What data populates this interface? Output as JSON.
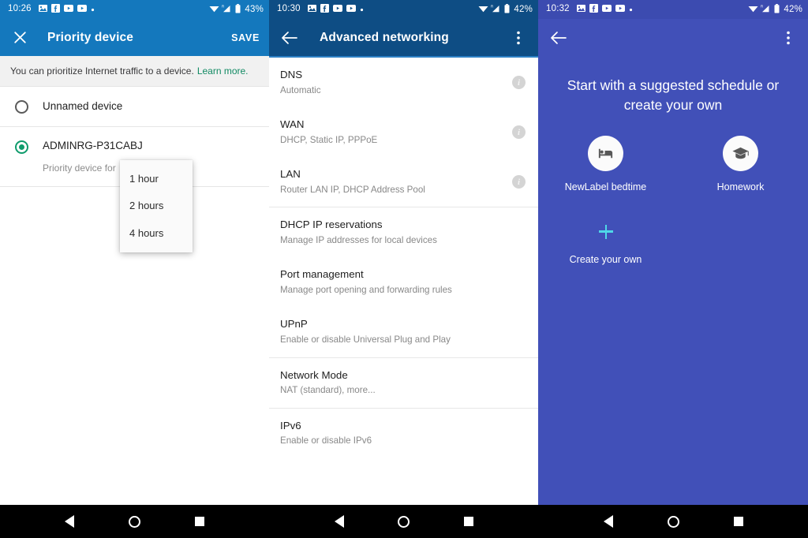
{
  "panels": [
    {
      "status": {
        "time": "10:26",
        "battery_pct": "43%",
        "icons": [
          "photo-icon",
          "facebook-icon",
          "youtube-icon",
          "youtube-icon",
          "dot-icon"
        ],
        "right_icons": [
          "wifi-icon",
          "signal-roaming-icon",
          "battery-icon"
        ]
      },
      "appbar": {
        "nav_icon": "close-icon",
        "title": "Priority device",
        "action": "SAVE"
      },
      "banner": {
        "text": "You can prioritize Internet traffic to a device.",
        "link": "Learn more."
      },
      "devices": [
        {
          "name": "Unnamed device",
          "selected": false,
          "sub": ""
        },
        {
          "name": "ADMINRG-P31CABJ",
          "selected": true,
          "sub": "Priority device for"
        }
      ],
      "dropdown": {
        "items": [
          "1 hour",
          "2 hours",
          "4 hours"
        ]
      }
    },
    {
      "status": {
        "time": "10:30",
        "battery_pct": "42%",
        "icons": [
          "photo-icon",
          "facebook-icon",
          "youtube-icon",
          "youtube-icon",
          "dot-icon"
        ],
        "right_icons": [
          "wifi-icon",
          "signal-roaming-icon",
          "battery-icon"
        ]
      },
      "appbar": {
        "nav_icon": "back-arrow-icon",
        "title": "Advanced networking",
        "menu_icon": "overflow-menu-icon"
      },
      "groups": [
        {
          "items": [
            {
              "title": "DNS",
              "sub": "Automatic",
              "info": true
            },
            {
              "title": "WAN",
              "sub": "DHCP, Static IP, PPPoE",
              "info": true
            },
            {
              "title": "LAN",
              "sub": "Router LAN IP, DHCP Address Pool",
              "info": true
            }
          ]
        },
        {
          "items": [
            {
              "title": "DHCP IP reservations",
              "sub": "Manage IP addresses for local devices",
              "info": false
            },
            {
              "title": "Port management",
              "sub": "Manage port opening and forwarding rules",
              "info": false
            },
            {
              "title": "UPnP",
              "sub": "Enable or disable Universal Plug and Play",
              "info": false
            }
          ]
        },
        {
          "items": [
            {
              "title": "Network Mode",
              "sub": "NAT (standard), more...",
              "info": false
            }
          ]
        },
        {
          "items": [
            {
              "title": "IPv6",
              "sub": "Enable or disable IPv6",
              "info": false
            }
          ]
        }
      ]
    },
    {
      "status": {
        "time": "10:32",
        "battery_pct": "42%",
        "icons": [
          "photo-icon",
          "facebook-icon",
          "youtube-icon",
          "youtube-icon",
          "dot-icon"
        ],
        "right_icons": [
          "wifi-icon",
          "signal-roaming-icon",
          "battery-icon"
        ]
      },
      "appbar": {
        "nav_icon": "back-arrow-icon",
        "menu_icon": "overflow-menu-icon"
      },
      "heading": "Start with a suggested schedule or create your own",
      "cards": [
        {
          "label": "NewLabel bedtime",
          "icon": "bed-icon"
        },
        {
          "label": "Homework",
          "icon": "graduation-cap-icon"
        }
      ],
      "create": {
        "label": "Create your own",
        "icon": "plus-icon"
      }
    }
  ],
  "navbar": {
    "back": "back-triangle-icon",
    "home": "home-circle-icon",
    "recents": "recents-square-icon"
  },
  "colors": {
    "panel1_header": "#1478bd",
    "panel2_header": "#0e4d84",
    "panel3_bg": "#4150b8",
    "accent_green": "#0f9b6c",
    "accent_cyan": "#4fd8e8",
    "link_green": "#118a63"
  }
}
